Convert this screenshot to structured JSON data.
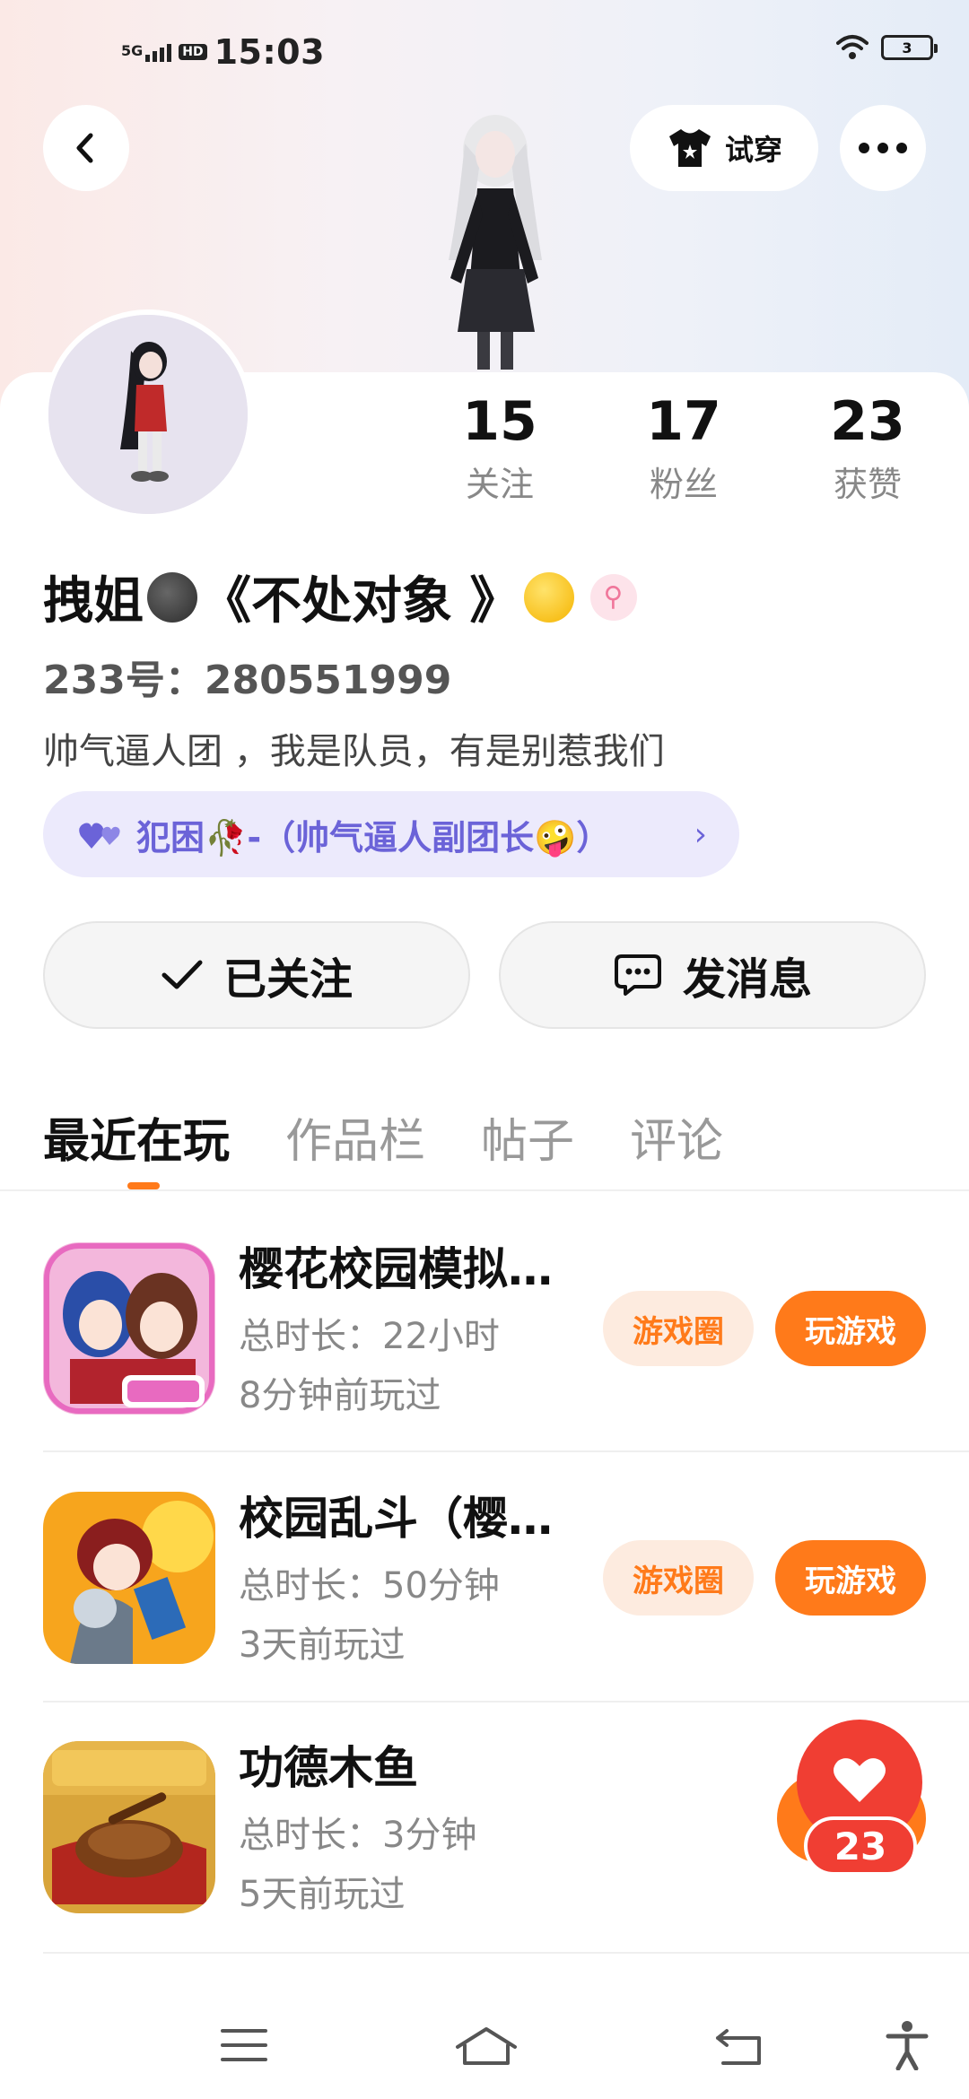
{
  "status_bar": {
    "network": "5G",
    "hd": "HD",
    "time": "15:03",
    "battery": "3"
  },
  "header": {
    "try_on_label": "试穿"
  },
  "profile": {
    "stats": [
      {
        "value": "15",
        "label": "关注"
      },
      {
        "value": "17",
        "label": "粉丝"
      },
      {
        "value": "23",
        "label": "获赞"
      }
    ],
    "nickname_part1": "拽姐",
    "nickname_part2": "《不处对象 》",
    "gender_symbol": "⚲",
    "uid": "233号：280551999",
    "bio": "帅气逼人团 ，我是队员，有是别惹我们",
    "group": "犯困🥀-（帅气逼人副团长🤪）"
  },
  "actions": {
    "follow_label": "已关注",
    "message_label": "发消息"
  },
  "tabs": [
    "最近在玩",
    "作品栏",
    "帖子",
    "评论"
  ],
  "games": [
    {
      "title": "樱花校园模拟…",
      "duration": "总时长：22小时",
      "last_played": "8分钟前玩过",
      "circle_label": "游戏圈",
      "play_label": "玩游戏"
    },
    {
      "title": "校园乱斗（樱…",
      "duration": "总时长：50分钟",
      "last_played": "3天前玩过",
      "circle_label": "游戏圈",
      "play_label": "玩游戏"
    },
    {
      "title": "功德木鱼",
      "duration": "总时长：3分钟",
      "last_played": "5天前玩过"
    }
  ],
  "like_float": {
    "count": "23"
  },
  "colors": {
    "accent": "#ff7a1a",
    "group_chip_bg": "#eceafc",
    "group_chip_text": "#6b63d8",
    "like_red": "#f03e33"
  }
}
